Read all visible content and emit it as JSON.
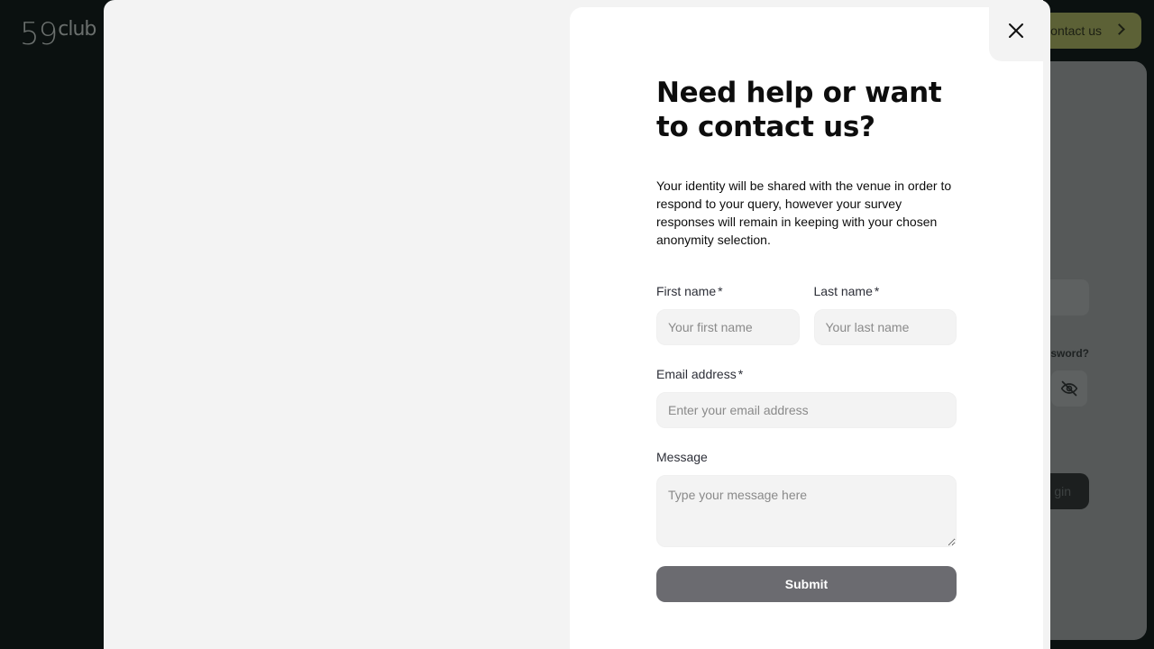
{
  "background": {
    "logo_number": "59",
    "logo_text": "club",
    "contact_button": "Contact us",
    "forgot_password": "ssword?",
    "login_button": "gin"
  },
  "modal": {
    "title": "Need help or want to contact us?",
    "description": "Your identity will be shared with the venue in order to respond to your query, however your survey responses will remain in keeping with your chosen anonymity selection.",
    "fields": {
      "first_name": {
        "label": "First name",
        "required_mark": "*",
        "placeholder": "Your first name"
      },
      "last_name": {
        "label": "Last name",
        "required_mark": "*",
        "placeholder": "Your last name"
      },
      "email": {
        "label": "Email address",
        "required_mark": "*",
        "placeholder": "Enter your email address"
      },
      "message": {
        "label": "Message",
        "placeholder": "Type your message here"
      }
    },
    "submit_label": "Submit"
  },
  "colors": {
    "backdrop": "#0b1110",
    "modal_bg": "#f3f3f3",
    "card_bg": "#ffffff",
    "submit_bg": "#6b6b70",
    "contact_bg": "#5c6136"
  },
  "icons": {
    "close": "close-icon",
    "eye_off": "eye-off-icon",
    "chevron": "chevron-right-icon"
  }
}
